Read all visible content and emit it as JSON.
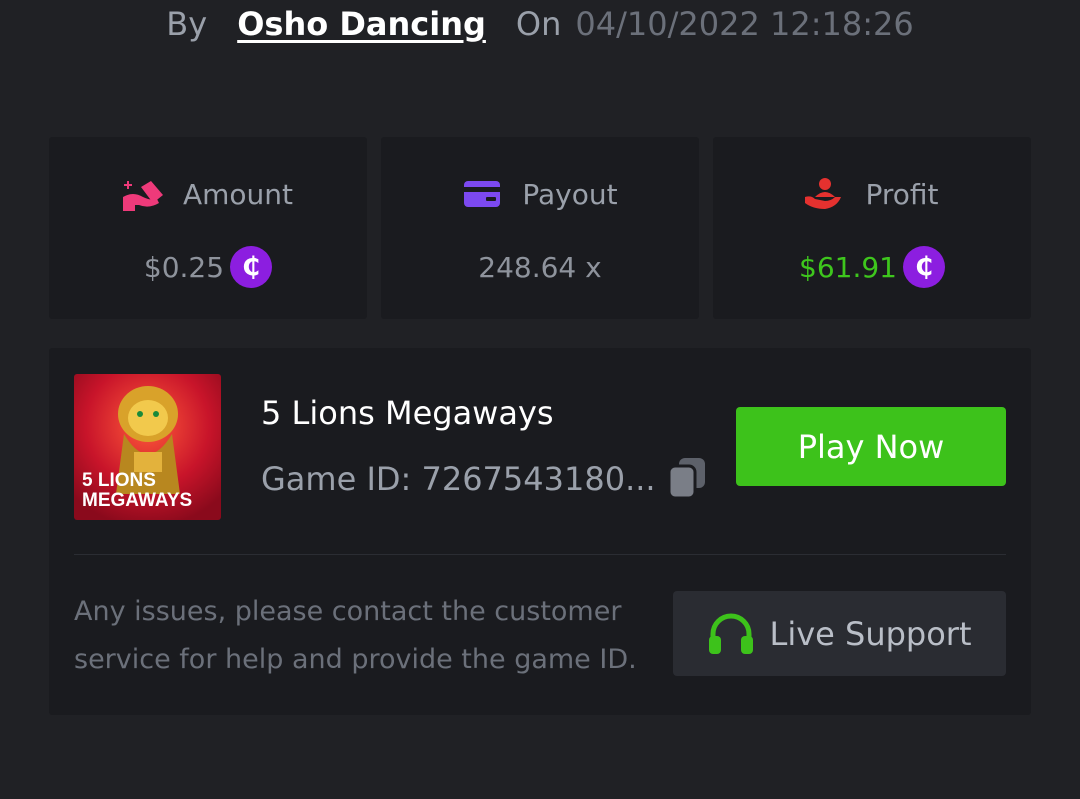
{
  "header": {
    "by_label": "By",
    "username": "Osho Dancing",
    "on_label": "On",
    "datetime": "04/10/2022 12:18:26"
  },
  "stats": {
    "amount": {
      "label": "Amount",
      "value": "$0.25",
      "icon": "hand-coins-icon",
      "icon_color": "#ee3a7a"
    },
    "payout": {
      "label": "Payout",
      "value": "248.64 x",
      "icon": "card-icon",
      "icon_color": "#7c49f0"
    },
    "profit": {
      "label": "Profit",
      "value": "$61.91",
      "icon": "hand-user-icon",
      "icon_color": "#e5312f"
    },
    "currency_symbol": "₵"
  },
  "game": {
    "name": "5 Lions Megaways",
    "id_text": "Game ID: 7267543180...",
    "thumbnail_line1": "5 LIONS",
    "thumbnail_line2": "MEGAWAYS",
    "play_label": "Play Now"
  },
  "support": {
    "help_text": "Any issues, please contact the customer service for help and provide the game ID.",
    "button_label": "Live Support"
  },
  "colors": {
    "background": "#202125",
    "card": "#1a1b1f",
    "accent_green": "#3dc21b",
    "profit_green": "#3ec61d",
    "coin_purple": "#8c1ee0"
  }
}
